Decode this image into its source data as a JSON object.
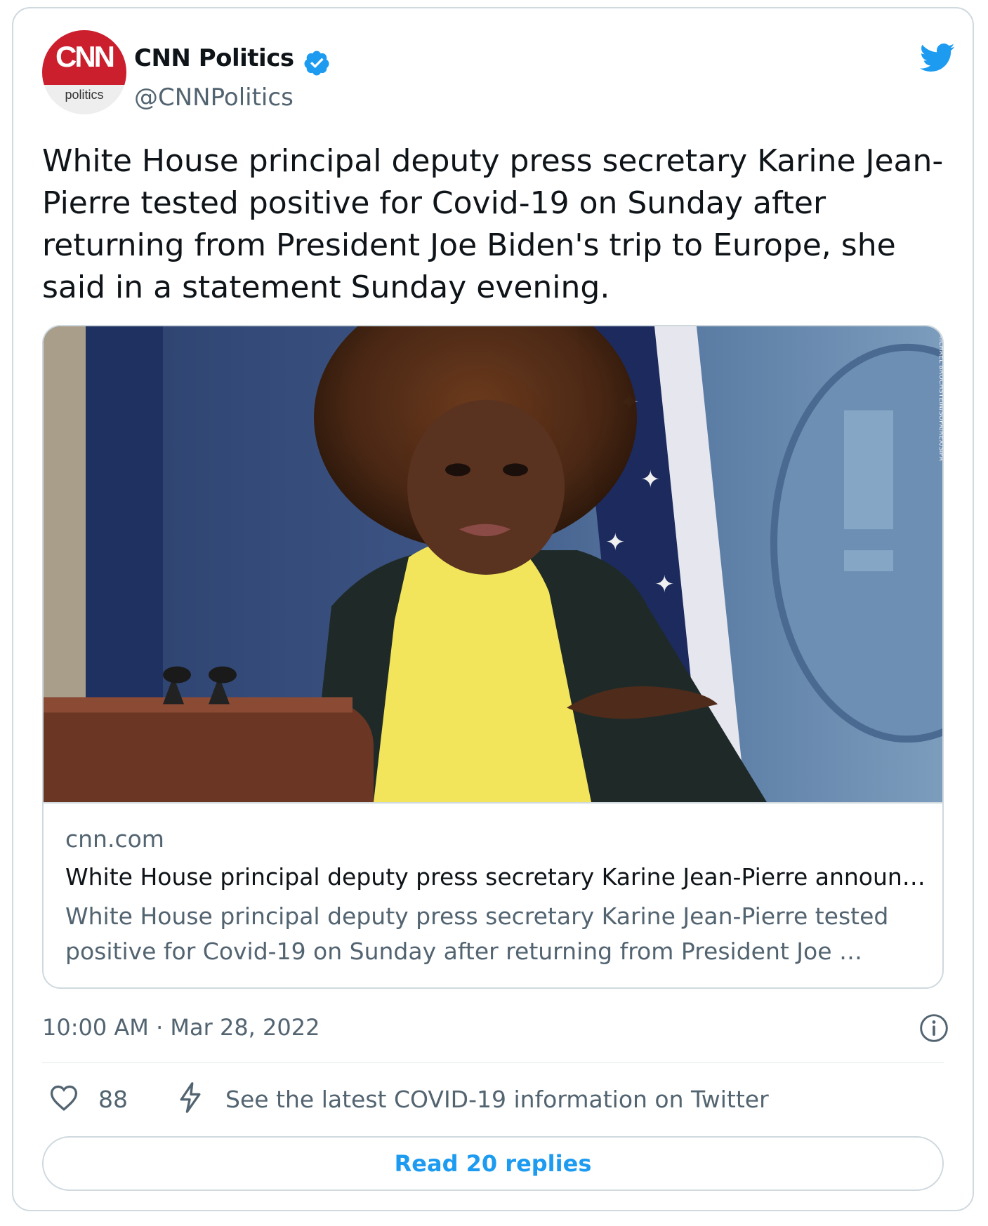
{
  "author": {
    "name": "CNN Politics",
    "handle": "@CNNPolitics",
    "verified": true,
    "avatar_logo_text": "CNN",
    "avatar_sub_text": "politics"
  },
  "tweet": {
    "text": "White House principal deputy press secretary Karine Jean-Pierre tested positive for Covid-19 on Sunday after returning from President Joe Biden's trip to Europe, she said in a statement Sunday evening."
  },
  "link_card": {
    "domain": "cnn.com",
    "title": "White House principal deputy press secretary Karine Jean-Pierre announ…",
    "description": "White House principal deputy press secretary Karine Jean-Pierre tested positive for Covid-19 on Sunday after returning from President Joe …",
    "photo_credit": "MICHAEL BROCHSTEIN/SOPA/REX/SIPA"
  },
  "meta": {
    "timestamp": "10:00 AM · Mar 28, 2022"
  },
  "actions": {
    "like_count": "88",
    "covid_info": "See the latest COVID-19 information on Twitter",
    "read_replies": "Read 20 replies"
  },
  "colors": {
    "brand_blue": "#1d9bf0",
    "secondary_text": "#536471",
    "border": "#cfd9de",
    "cnn_red": "#cc1f2e"
  },
  "icons": [
    "twitter-bird-icon",
    "verified-badge-icon",
    "info-icon",
    "heart-icon",
    "lightning-bolt-icon"
  ]
}
